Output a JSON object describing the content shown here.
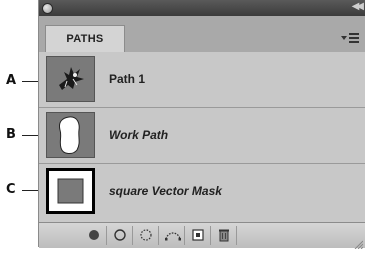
{
  "panel": {
    "tab_label": "PATHS",
    "items": [
      {
        "label": "Path 1",
        "italic": false,
        "callout": "A"
      },
      {
        "label": "Work Path",
        "italic": true,
        "callout": "B"
      },
      {
        "label": "square Vector Mask",
        "italic": true,
        "callout": "C"
      }
    ]
  },
  "toolbar": {
    "buttons": [
      "fill-path-icon",
      "stroke-path-icon",
      "load-as-selection-icon",
      "make-work-path-icon",
      "new-path-icon",
      "delete-path-icon"
    ]
  },
  "colors": {
    "panel_bg": "#b3b3b3",
    "row_bg": "#c8c8c8",
    "tab_bg": "#d4d4d4",
    "titlebar": "#3b3b3b"
  }
}
